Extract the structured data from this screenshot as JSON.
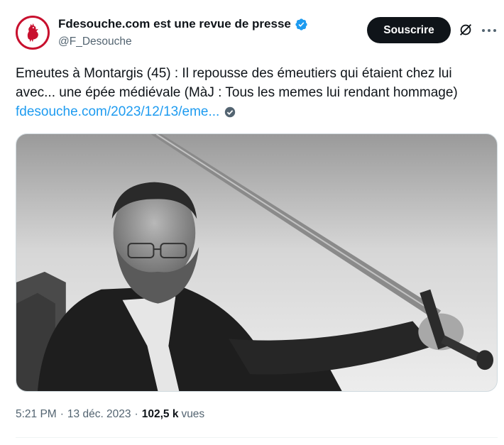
{
  "author": {
    "display_name": "Fdesouche.com est une revue de presse",
    "handle": "@F_Desouche",
    "avatar_icon": "rooster-logo",
    "verified_icon": "verified-badge-icon",
    "verified_color": "#1d9bf0"
  },
  "actions": {
    "subscribe_label": "Souscrire",
    "grok_icon": "grok-icon",
    "more_icon": "more-options-icon"
  },
  "tweet": {
    "text_line1": "Emeutes à Montargis (45) : Il repousse des émeutiers qui étaient chez lui",
    "text_line2": "avec... une épée médiévale (MàJ : Tous les memes lui rendant hommage)",
    "link_text": "fdesouche.com/2023/12/13/eme...",
    "link_badge_icon": "check-circle-icon"
  },
  "media": {
    "description_icon": "photo-icon"
  },
  "meta": {
    "time": "5:21 PM",
    "date": "13 déc. 2023",
    "views_count": "102,5 k",
    "views_label": "vues"
  },
  "colors": {
    "accent": "#1d9bf0",
    "button_bg": "#0f1419",
    "secondary_text": "#536471",
    "brand_red": "#c8102e"
  }
}
